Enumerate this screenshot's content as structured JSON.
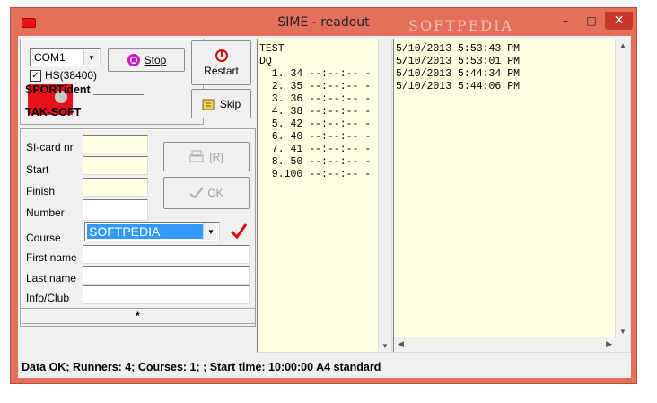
{
  "window": {
    "title": "SIME - readout",
    "watermark": "SOFTPEDIA",
    "minimize": "–",
    "maximize": "□",
    "close": "✕"
  },
  "connection": {
    "port": "COM1",
    "hs_label": "HS(38400)",
    "hs_checked": true,
    "stop_label": "Stop",
    "restart_label": "Restart",
    "skip_label": "Skip"
  },
  "logo": {
    "line1": "SPORTident",
    "line2": "TAK-SOFT",
    "underline": "________"
  },
  "form": {
    "sicard_label": "SI-card nr",
    "start_label": "Start",
    "finish_label": "Finish",
    "number_label": "Number",
    "course_label": "Course",
    "course_value": "SOFTPEDIA",
    "firstname_label": "First name",
    "lastname_label": "Last name",
    "infoclub_label": "Info/Club",
    "r_label": "[R]",
    "ok_label": "OK",
    "footer_marker": "*"
  },
  "readout": {
    "lines": [
      "TEST",
      "DQ",
      "  1. 34 --:--:-- -",
      "  2. 35 --:--:-- -",
      "  3. 36 --:--:-- -",
      "  4. 38 --:--:-- -",
      "  5. 42 --:--:-- -",
      "  6. 40 --:--:-- -",
      "  7. 41 --:--:-- -",
      "  8. 50 --:--:-- -",
      "  9.100 --:--:-- -"
    ]
  },
  "log": {
    "lines": [
      "5/10/2013 5:53:43 PM",
      "5/10/2013 5:53:01 PM",
      "5/10/2013 5:44:34 PM",
      "5/10/2013 5:44:06 PM"
    ]
  },
  "status": "Data OK; Runners: 4; Courses: 1; ; Start time: 10:00:00  A4 standard"
}
